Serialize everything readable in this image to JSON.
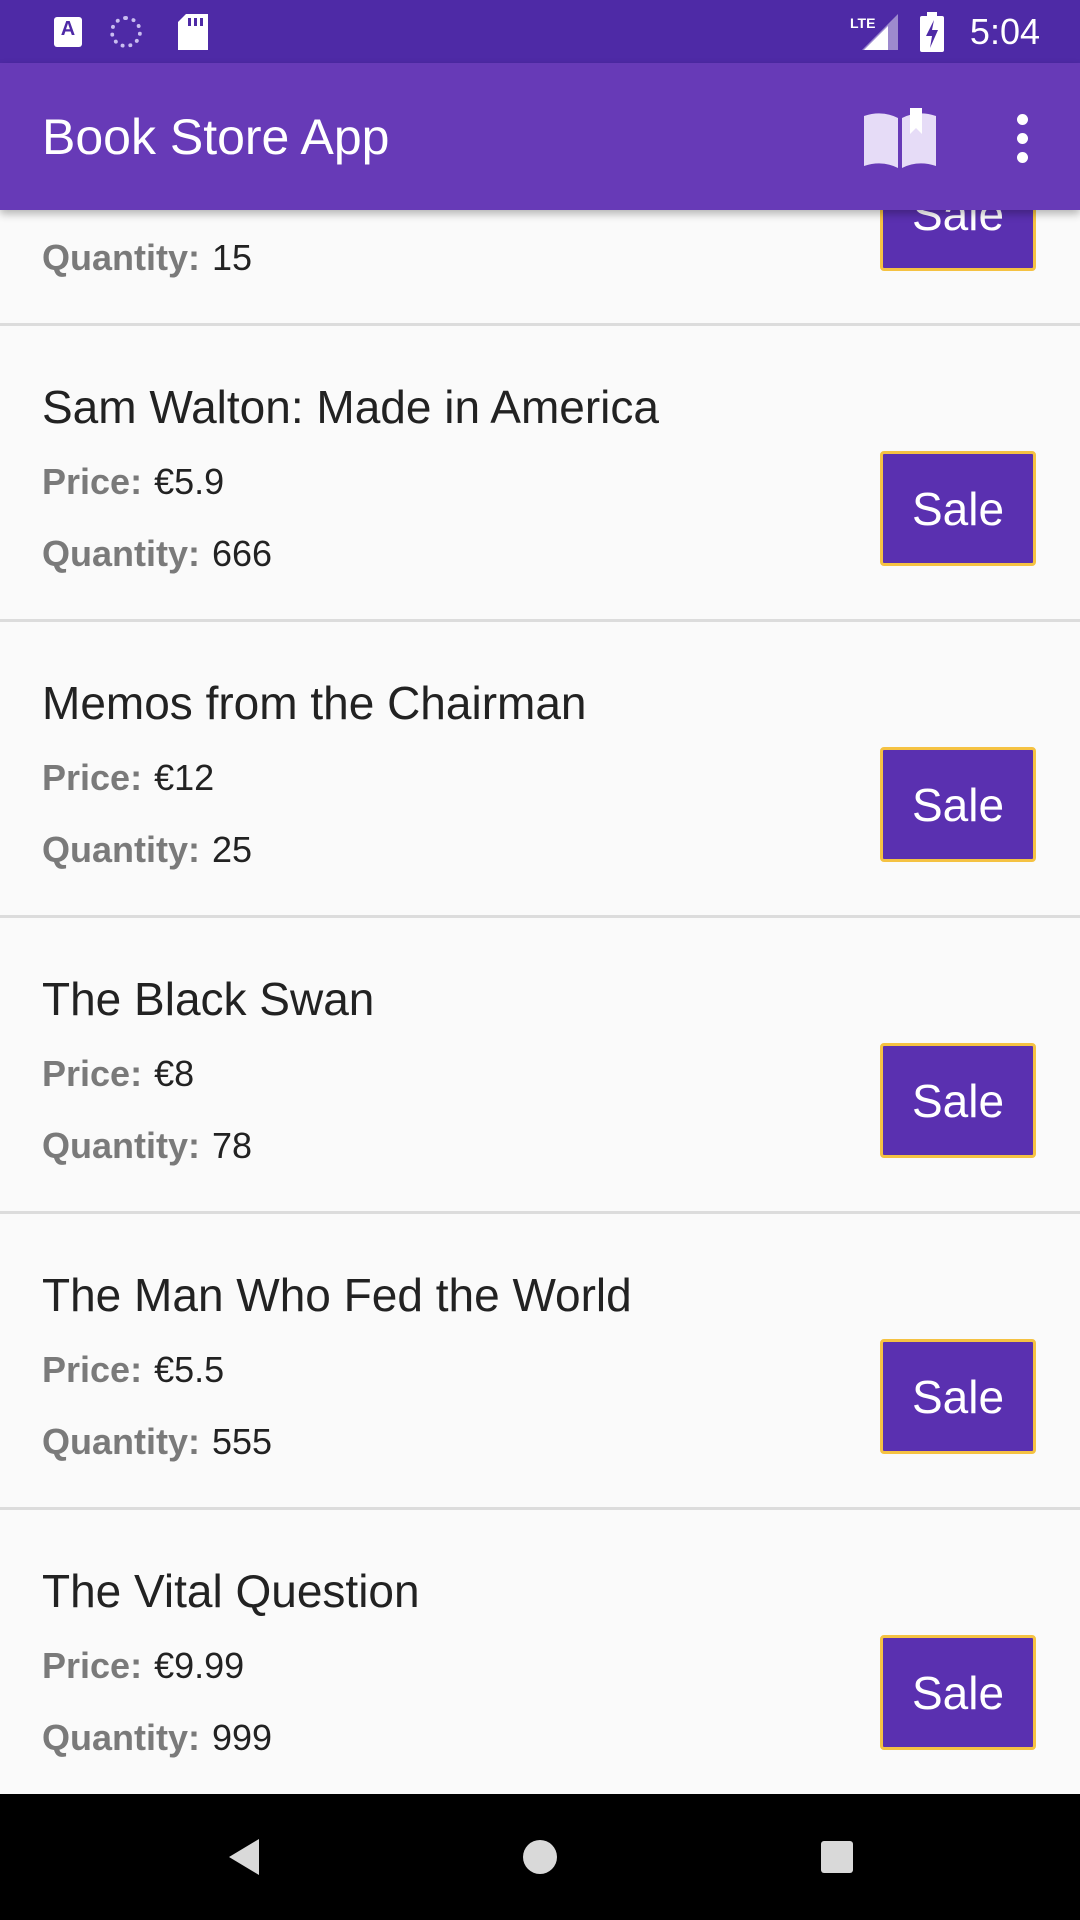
{
  "status_bar": {
    "time": "5:04",
    "network": "LTE",
    "icons": [
      "a-notification-icon",
      "sync-icon",
      "sd-card-icon",
      "lte-signal-icon",
      "battery-charging-icon"
    ]
  },
  "app_bar": {
    "title": "Book Store App",
    "actions": [
      "open-book-icon",
      "overflow-menu-icon"
    ]
  },
  "list": {
    "partial_item": {
      "quantity_label": "Quantity:",
      "quantity": "15",
      "sale_label": "Sale"
    },
    "items": [
      {
        "title": "Sam Walton: Made in America",
        "price_label": "Price:",
        "price": "€5.9",
        "quantity_label": "Quantity:",
        "quantity": "666",
        "sale_label": "Sale"
      },
      {
        "title": "Memos from the Chairman",
        "price_label": "Price:",
        "price": "€12",
        "quantity_label": "Quantity:",
        "quantity": "25",
        "sale_label": "Sale"
      },
      {
        "title": "The Black Swan",
        "price_label": "Price:",
        "price": "€8",
        "quantity_label": "Quantity:",
        "quantity": "78",
        "sale_label": "Sale"
      },
      {
        "title": "The Man Who Fed the World",
        "price_label": "Price:",
        "price": "€5.5",
        "quantity_label": "Quantity:",
        "quantity": "555",
        "sale_label": "Sale"
      },
      {
        "title": "The Vital Question",
        "price_label": "Price:",
        "price": "€9.99",
        "quantity_label": "Quantity:",
        "quantity": "999",
        "sale_label": "Sale"
      }
    ]
  },
  "nav_bar": {
    "buttons": [
      "back-icon",
      "home-icon",
      "recents-icon"
    ]
  },
  "colors": {
    "primary": "#673ab7",
    "primary_dark": "#4e2aa6",
    "button": "#5a30b0",
    "button_border": "#f5c242"
  }
}
